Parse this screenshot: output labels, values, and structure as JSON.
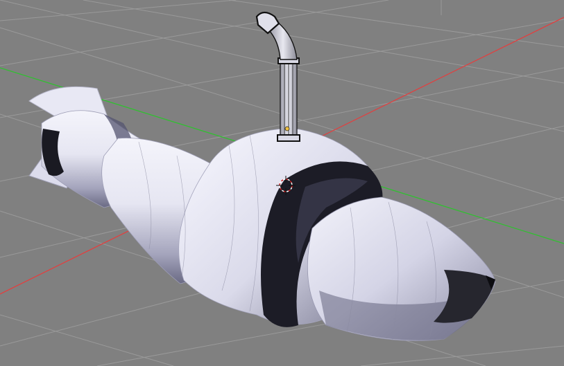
{
  "viewport": {
    "view": "3d-perspective",
    "background_color": "#808080",
    "grid_color": "#9a9a9a",
    "x_axis_color": "#e04040",
    "y_axis_color": "#30c030",
    "object": {
      "name": "submarine-mesh",
      "shading": "solid",
      "base_color": "#eeeef8",
      "shadow_color": "#5a5a72",
      "dark_band_color": "#1a1a22",
      "wire_color": "#111111"
    },
    "cursor_icon": "3d-cursor-icon",
    "origin_icon": "object-origin-icon"
  }
}
